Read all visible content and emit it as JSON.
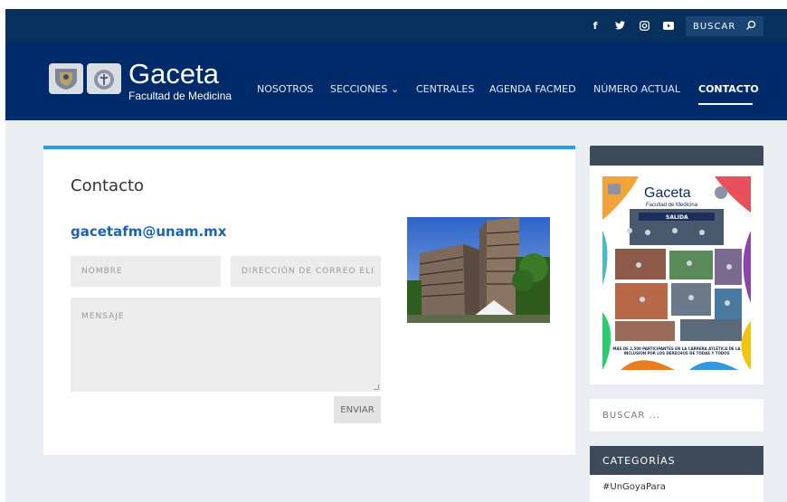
{
  "topbar": {
    "social": [
      {
        "glyph": "f",
        "icon": "facebook-icon"
      },
      {
        "glyph": "🐦",
        "icon": "twitter-icon"
      },
      {
        "glyph": "◘",
        "icon": "instagram-icon"
      },
      {
        "glyph": "▶",
        "icon": "youtube-icon"
      }
    ],
    "search_label": "BUSCAR",
    "search_icon": "⌕"
  },
  "brand": {
    "title": "Gaceta",
    "subtitle": "Facultad de Medicina"
  },
  "nav": {
    "items": [
      {
        "label": "NOSOTROS"
      },
      {
        "label": "SECCIONES ⌄"
      },
      {
        "label": "CENTRALES"
      },
      {
        "label": "AGENDA FACMED"
      },
      {
        "label": "NÚMERO ACTUAL"
      },
      {
        "label": "CONTACTO"
      }
    ]
  },
  "contact": {
    "title": "Contacto",
    "email": "gacetafm@unam.mx",
    "name_placeholder": "NOMBRE",
    "email_placeholder": "DIRECCIÓN DE CORREO ELI",
    "message_placeholder": "MENSAJE",
    "send_label": "ENVIAR"
  },
  "sidebar": {
    "cover": {
      "brand": "Gaceta",
      "brand_sub": "Facultad de Medicina",
      "banner": "SALIDA",
      "caption": "MÁS DE 2,500 PARTICIPANTES EN LA CARRERA ATLÉTICA DE LA INCLUSIÓN POR LOS DERECHOS DE TODAS Y TODOS"
    },
    "search_placeholder": "BUSCAR ...",
    "categories_title": "CATEGORÍAS",
    "categories": [
      "#UnGoyaPara"
    ]
  },
  "colors": {
    "topbar": "#07305d",
    "navbar": "#002b6b",
    "accent": "#2b9be6",
    "email": "#1d63b3",
    "sidebar_head": "#3c4a5a"
  }
}
